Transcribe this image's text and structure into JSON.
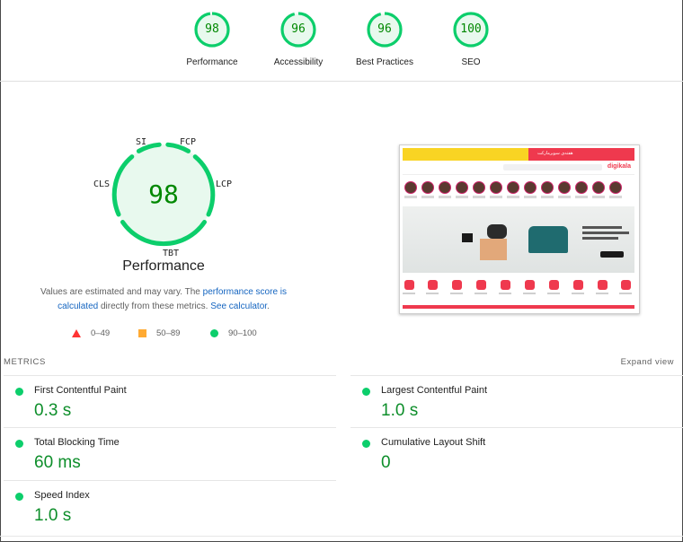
{
  "colors": {
    "pass": "#0cce6b",
    "pass_text": "#008800",
    "average": "#ffaa33",
    "fail": "#ff3333",
    "link": "#1565c0"
  },
  "categories": [
    {
      "score": 98,
      "label": "Performance"
    },
    {
      "score": 96,
      "label": "Accessibility"
    },
    {
      "score": 96,
      "label": "Best Practices"
    },
    {
      "score": 100,
      "label": "SEO"
    }
  ],
  "performance": {
    "score": 98,
    "title": "Performance",
    "metric_labels": {
      "si": "SI",
      "fcp": "FCP",
      "lcp": "LCP",
      "tbt": "TBT",
      "cls": "CLS"
    }
  },
  "note": {
    "prefix": "Values are estimated and may vary. The ",
    "link1": "performance score is calculated",
    "middle": " directly from these metrics. ",
    "link2": "See calculator",
    "suffix": "."
  },
  "legend": {
    "fail": "0–49",
    "average": "50–89",
    "pass": "90–100"
  },
  "thumbnail": {
    "logo": "digikala",
    "promo": "هفته‌ی سوپرمارکت"
  },
  "metrics_section": {
    "header": "METRICS",
    "expand": "Expand view",
    "items": [
      {
        "name": "First Contentful Paint",
        "value": "0.3 s"
      },
      {
        "name": "Largest Contentful Paint",
        "value": "1.0 s"
      },
      {
        "name": "Total Blocking Time",
        "value": "60 ms"
      },
      {
        "name": "Cumulative Layout Shift",
        "value": "0"
      },
      {
        "name": "Speed Index",
        "value": "1.0 s"
      }
    ]
  }
}
